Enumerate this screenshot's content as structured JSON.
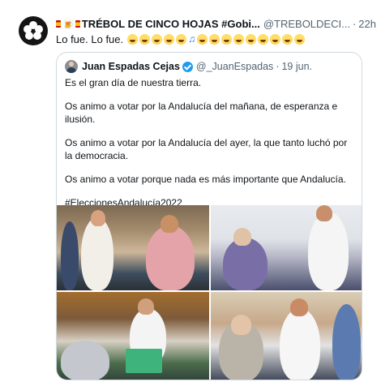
{
  "tweet": {
    "author_name": "TRÉBOL DE CINCO HOJAS #Gobi...",
    "author_handle": "@TREBOLDECI...",
    "separator": "·",
    "time": "22h",
    "text": "Lo fue. Lo fue.",
    "emoji_count": 15
  },
  "quoted_tweet": {
    "author_name": "Juan Espadas Cejas",
    "author_handle": "@_JuanEspadas",
    "separator": "·",
    "date": "19 jun.",
    "paragraphs": [
      "Es el gran día de nuestra tierra.",
      "Os animo a votar por la Andalucía del mañana, de esperanza e ilusión.",
      "Os animo a votar por la Andalucía del ayer, la que tanto luchó por la democracia.",
      "Os animo a votar porque nada es más importante que Andalucía.",
      "#EleccionesAndalucía2022"
    ],
    "photos": [
      "photo-1",
      "photo-2",
      "photo-3",
      "photo-4"
    ]
  },
  "icons": {
    "avatar": "clover-logo-icon",
    "verified": "verified-badge-icon",
    "flag": "spain-flag-icon",
    "beer": "beer-icon"
  },
  "colors": {
    "text": "#0f1419",
    "secondary": "#536471",
    "border": "#cfd9de",
    "verified": "#1d9bf0"
  }
}
